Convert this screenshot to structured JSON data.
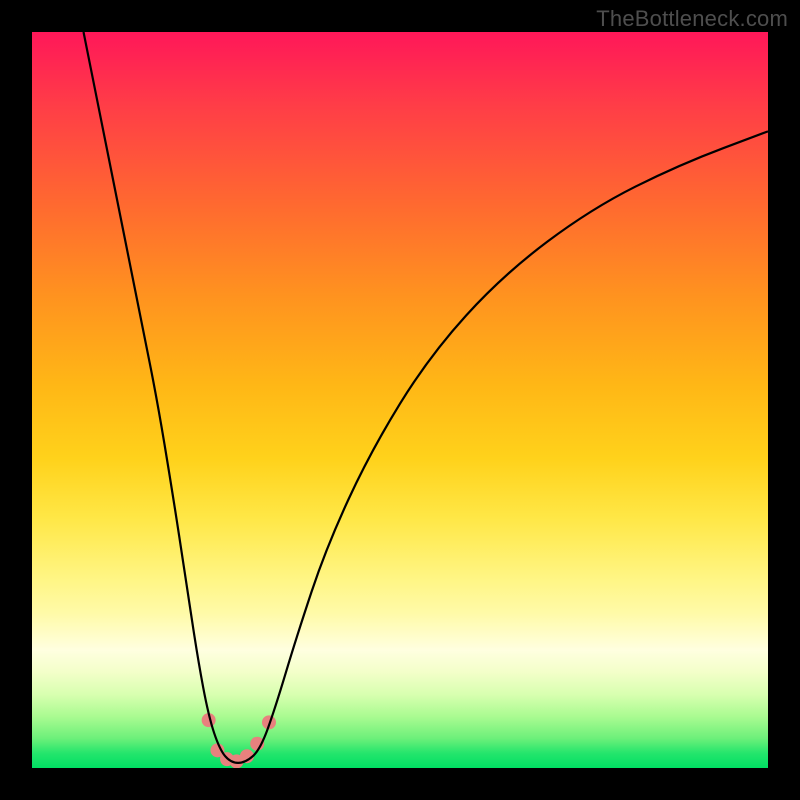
{
  "watermark": "TheBottleneck.com",
  "chart_data": {
    "type": "line",
    "title": "",
    "xlabel": "",
    "ylabel": "",
    "xlim": [
      0,
      100
    ],
    "ylim": [
      0,
      100
    ],
    "grid": false,
    "legend": false,
    "background_gradient": {
      "stops": [
        {
          "pos": 0,
          "color": "#ff1759"
        },
        {
          "pos": 0.1,
          "color": "#ff3d47"
        },
        {
          "pos": 0.24,
          "color": "#ff6b2f"
        },
        {
          "pos": 0.36,
          "color": "#ff931f"
        },
        {
          "pos": 0.48,
          "color": "#ffb716"
        },
        {
          "pos": 0.58,
          "color": "#ffd21b"
        },
        {
          "pos": 0.66,
          "color": "#ffe746"
        },
        {
          "pos": 0.74,
          "color": "#fff582"
        },
        {
          "pos": 0.79,
          "color": "#fffaa8"
        },
        {
          "pos": 0.84,
          "color": "#ffffe0"
        },
        {
          "pos": 0.87,
          "color": "#f3ffc9"
        },
        {
          "pos": 0.9,
          "color": "#d8ffb0"
        },
        {
          "pos": 0.93,
          "color": "#aafb91"
        },
        {
          "pos": 0.96,
          "color": "#6cf07a"
        },
        {
          "pos": 0.98,
          "color": "#24e56c"
        },
        {
          "pos": 1.0,
          "color": "#00df63"
        }
      ]
    },
    "curve": {
      "name": "bottleneck-curve",
      "color": "#000000",
      "stroke_width": 2.2,
      "points": [
        {
          "x": 7.0,
          "y": 100.0
        },
        {
          "x": 9.0,
          "y": 90.0
        },
        {
          "x": 11.0,
          "y": 80.0
        },
        {
          "x": 13.0,
          "y": 70.0
        },
        {
          "x": 15.0,
          "y": 60.0
        },
        {
          "x": 17.0,
          "y": 50.0
        },
        {
          "x": 19.0,
          "y": 38.0
        },
        {
          "x": 21.0,
          "y": 25.0
        },
        {
          "x": 22.5,
          "y": 15.0
        },
        {
          "x": 24.0,
          "y": 7.0
        },
        {
          "x": 25.5,
          "y": 2.5
        },
        {
          "x": 27.0,
          "y": 0.7
        },
        {
          "x": 29.0,
          "y": 0.7
        },
        {
          "x": 31.0,
          "y": 2.5
        },
        {
          "x": 33.0,
          "y": 8.0
        },
        {
          "x": 36.0,
          "y": 18.0
        },
        {
          "x": 40.0,
          "y": 30.0
        },
        {
          "x": 46.0,
          "y": 43.0
        },
        {
          "x": 54.0,
          "y": 56.0
        },
        {
          "x": 64.0,
          "y": 67.0
        },
        {
          "x": 76.0,
          "y": 76.0
        },
        {
          "x": 88.0,
          "y": 82.0
        },
        {
          "x": 100.0,
          "y": 86.5
        }
      ]
    },
    "scatter_points": {
      "color": "#e8817e",
      "radius": 7,
      "points": [
        {
          "x": 24.0,
          "y": 6.5
        },
        {
          "x": 25.2,
          "y": 2.4
        },
        {
          "x": 26.5,
          "y": 1.2
        },
        {
          "x": 27.8,
          "y": 0.9
        },
        {
          "x": 29.2,
          "y": 1.6
        },
        {
          "x": 30.6,
          "y": 3.3
        },
        {
          "x": 32.2,
          "y": 6.2
        }
      ]
    }
  }
}
